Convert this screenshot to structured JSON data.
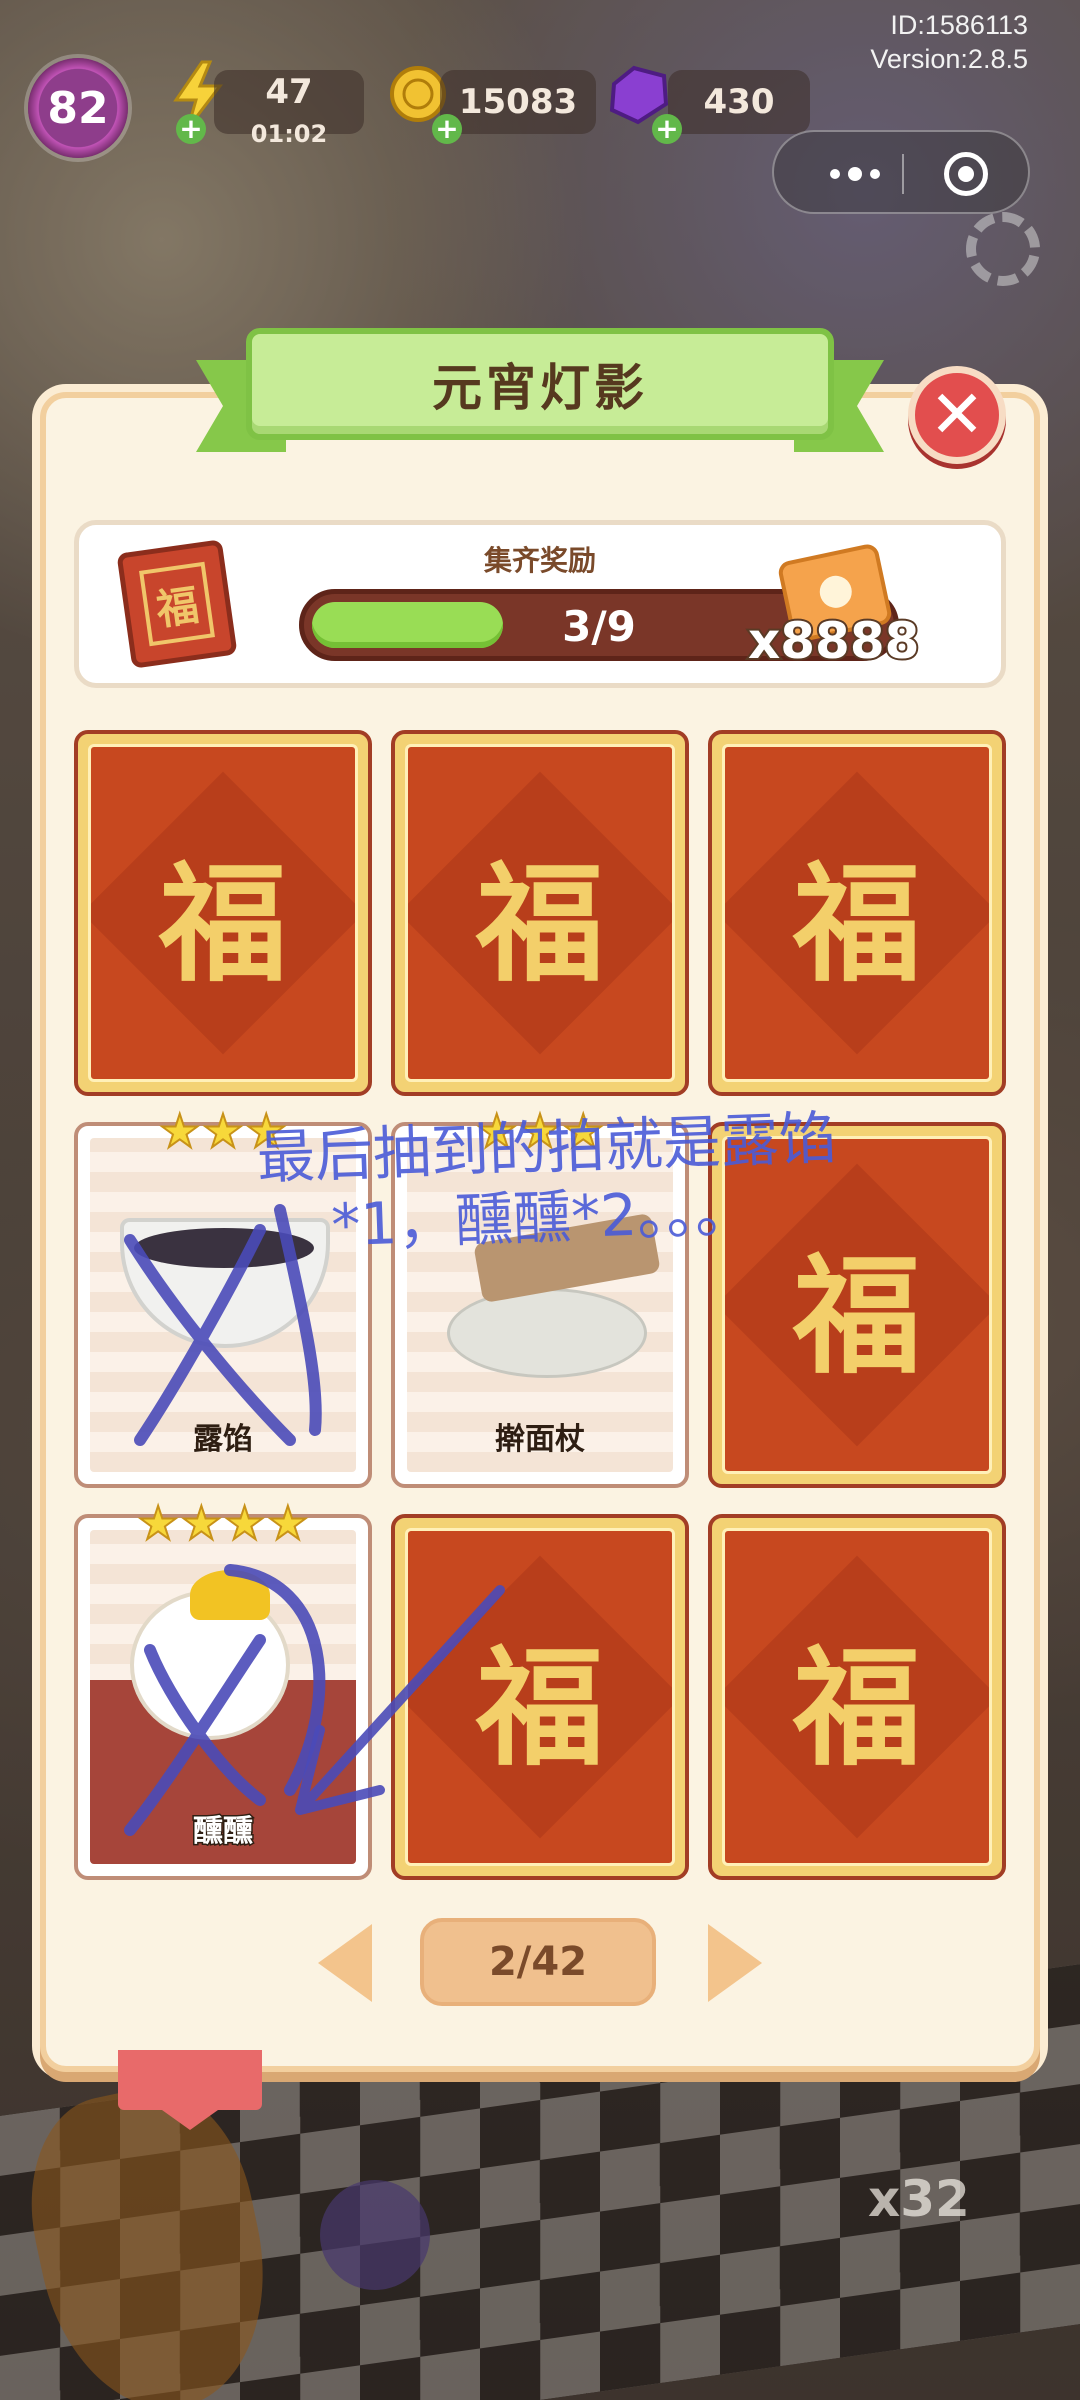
{
  "status": {
    "id_line": "ID:1586113",
    "version_line": "Version:2.8.5"
  },
  "hud": {
    "level": "82",
    "energy": "47",
    "energy_timer": "01:02",
    "coins": "15083",
    "gems": "430"
  },
  "panel": {
    "title": "元宵灯影",
    "reward_label": "集齐奖励",
    "progress_text": "3/9",
    "progress_fraction": 0.333,
    "reward_amount": "x8888",
    "fu_char": "福"
  },
  "cards": [
    {
      "type": "fu",
      "char": "福"
    },
    {
      "type": "fu",
      "char": "福"
    },
    {
      "type": "fu",
      "char": "福"
    },
    {
      "type": "item",
      "name": "露馅",
      "stars": 3
    },
    {
      "type": "item",
      "name": "擀面杖",
      "stars": 3
    },
    {
      "type": "fu",
      "char": "福"
    },
    {
      "type": "item",
      "name": "醺醺",
      "stars": 4
    },
    {
      "type": "fu",
      "char": "福"
    },
    {
      "type": "fu",
      "char": "福"
    }
  ],
  "annotation": {
    "line1": "最后抽到的拍就是露馅",
    "line2": "*1，醺醺*2。。。"
  },
  "pagination": {
    "page_text": "2/42"
  },
  "background": {
    "bubble_count": "x32"
  },
  "icons": {
    "close": "close-icon",
    "prev": "arrow-left-icon",
    "next": "arrow-right-icon",
    "more": "more-dots-icon",
    "target": "target-icon",
    "settings": "gear-icon"
  }
}
